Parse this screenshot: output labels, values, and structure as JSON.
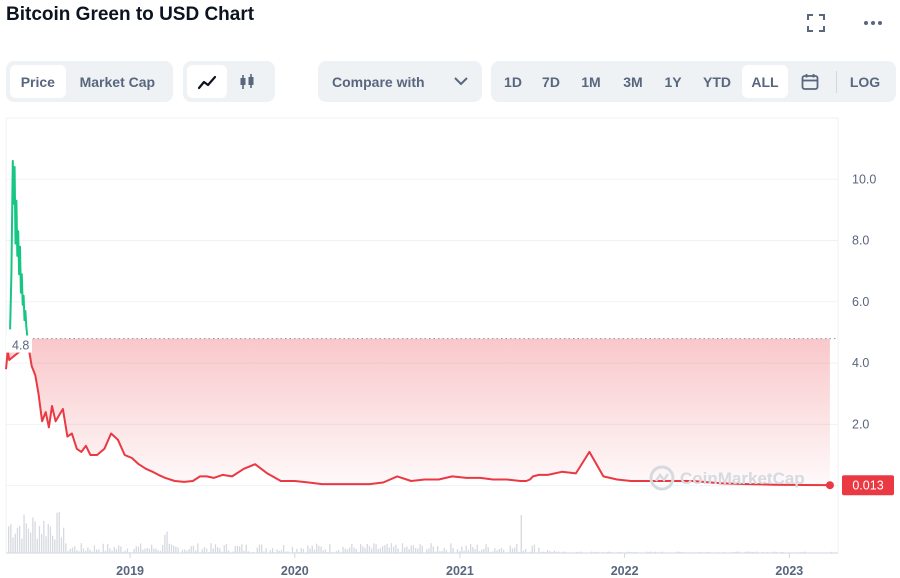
{
  "header": {
    "title": "Bitcoin Green to USD Chart"
  },
  "toolbar": {
    "price_label": "Price",
    "market_cap_label": "Market Cap",
    "compare_label": "Compare with",
    "ranges": [
      "1D",
      "7D",
      "1M",
      "3M",
      "1Y",
      "YTD",
      "ALL"
    ],
    "active_range": "ALL",
    "log_label": "LOG"
  },
  "icons": {
    "fullscreen": "fullscreen-icon",
    "more": "more-icon",
    "line_chart": "line-chart-icon",
    "candlestick": "candlestick-icon",
    "calendar": "calendar-icon",
    "dropdown": "chevron-down-icon"
  },
  "watermark": "CoinMarketCap",
  "colors": {
    "down": "#ea3943",
    "up": "#16c784",
    "text_muted": "#58667e"
  },
  "chart_data": {
    "type": "area",
    "y_ticks": [
      "10.0",
      "8.0",
      "6.0",
      "4.0",
      "2.0"
    ],
    "ylim": [
      -2.2,
      12
    ],
    "x_ticks": [
      "2019",
      "2020",
      "2021",
      "2022",
      "2023"
    ],
    "reference_line": {
      "value": 4.8,
      "label": "4.8"
    },
    "current_price": {
      "value": 0.013,
      "label": "0.013"
    },
    "series": [
      {
        "color": "#16c784",
        "x": [
          "2018-04-10",
          "2018-04-13",
          "2018-04-16",
          "2018-04-18",
          "2018-04-20",
          "2018-04-22",
          "2018-04-24",
          "2018-04-26",
          "2018-04-28",
          "2018-04-30",
          "2018-05-02",
          "2018-05-04",
          "2018-05-06",
          "2018-05-08",
          "2018-05-10",
          "2018-05-12",
          "2018-05-14",
          "2018-05-16",
          "2018-05-18"
        ],
        "values": [
          5.1,
          6.9,
          10.6,
          9.2,
          10.4,
          7.9,
          9.3,
          7.5,
          8.3,
          6.9,
          7.8,
          6.3,
          6.9,
          5.9,
          6.2,
          5.4,
          5.7,
          5.2,
          4.9
        ]
      },
      {
        "color": "#ea3943",
        "x": [
          "2018-04-01",
          "2018-04-05",
          "2018-04-08",
          "2018-05-20",
          "2018-05-28",
          "2018-06-05",
          "2018-06-12",
          "2018-06-20",
          "2018-06-28",
          "2018-07-05",
          "2018-07-12",
          "2018-07-20",
          "2018-07-28",
          "2018-08-05",
          "2018-08-15",
          "2018-08-25",
          "2018-09-05",
          "2018-09-15",
          "2018-09-25",
          "2018-10-05",
          "2018-10-20",
          "2018-11-05",
          "2018-11-20",
          "2018-12-05",
          "2018-12-20",
          "2019-01-05",
          "2019-01-20",
          "2019-02-05",
          "2019-02-20",
          "2019-03-05",
          "2019-03-20",
          "2019-04-10",
          "2019-05-01",
          "2019-05-20",
          "2019-06-05",
          "2019-06-20",
          "2019-07-05",
          "2019-07-25",
          "2019-08-15",
          "2019-09-10",
          "2019-10-05",
          "2019-11-01",
          "2019-12-01",
          "2020-01-01",
          "2020-02-01",
          "2020-03-01",
          "2020-03-20",
          "2020-04-15",
          "2020-05-15",
          "2020-06-15",
          "2020-07-15",
          "2020-08-15",
          "2020-09-15",
          "2020-10-15",
          "2020-11-15",
          "2020-12-15",
          "2021-01-15",
          "2021-02-15",
          "2021-03-15",
          "2021-04-15",
          "2021-05-15",
          "2021-05-28",
          "2021-06-05",
          "2021-06-12",
          "2021-06-25",
          "2021-07-15",
          "2021-08-15",
          "2021-09-15",
          "2021-10-15",
          "2021-11-15",
          "2021-12-15",
          "2022-01-15",
          "2022-02-15",
          "2022-04-01",
          "2022-06-01",
          "2022-08-01",
          "2022-10-01",
          "2022-12-01",
          "2023-02-01",
          "2023-04-01"
        ],
        "values": [
          3.8,
          4.4,
          4.1,
          4.6,
          3.9,
          3.6,
          3.0,
          2.1,
          2.4,
          1.9,
          2.6,
          2.1,
          2.3,
          2.5,
          1.6,
          1.7,
          1.2,
          1.1,
          1.3,
          1.0,
          1.0,
          1.2,
          1.7,
          1.5,
          1.0,
          0.9,
          0.7,
          0.55,
          0.45,
          0.35,
          0.25,
          0.15,
          0.12,
          0.15,
          0.3,
          0.3,
          0.25,
          0.35,
          0.3,
          0.55,
          0.7,
          0.4,
          0.15,
          0.15,
          0.1,
          0.05,
          0.05,
          0.05,
          0.05,
          0.05,
          0.1,
          0.3,
          0.15,
          0.2,
          0.2,
          0.3,
          0.25,
          0.25,
          0.2,
          0.2,
          0.15,
          0.15,
          0.2,
          0.3,
          0.35,
          0.35,
          0.45,
          0.4,
          1.1,
          0.3,
          0.2,
          0.15,
          0.15,
          0.15,
          0.15,
          0.08,
          0.05,
          0.03,
          0.02,
          0.015
        ]
      }
    ],
    "x_range": [
      "2018-04-01",
      "2023-04-10"
    ]
  }
}
